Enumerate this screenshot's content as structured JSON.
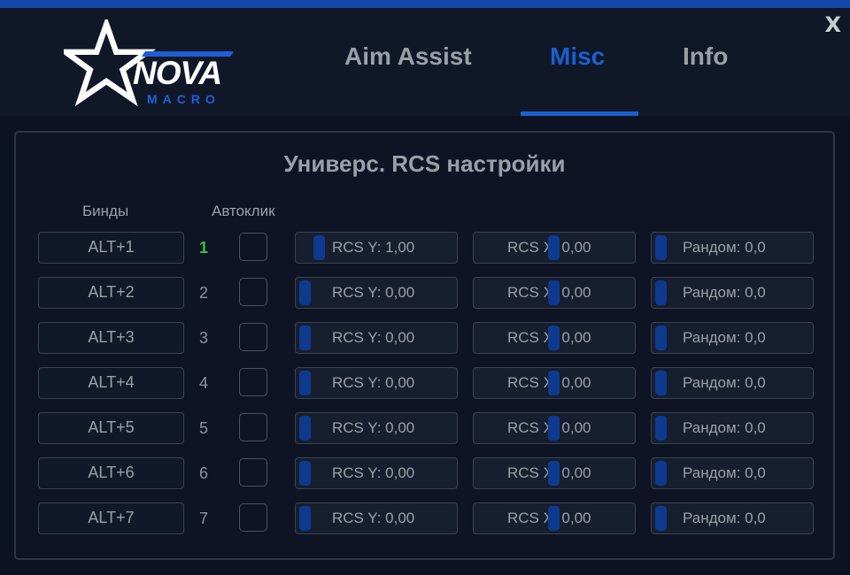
{
  "window": {
    "close_label": "X"
  },
  "logo": {
    "name": "NOVA",
    "sub": "MACRO"
  },
  "tabs": [
    {
      "label": "Aim Assist",
      "active": false
    },
    {
      "label": "Misc",
      "active": true
    },
    {
      "label": "Info",
      "active": false
    }
  ],
  "panel": {
    "title": "Универс. RCS настройки",
    "col_binds": "Бинды",
    "col_autoclick": "Автоклик"
  },
  "rows": [
    {
      "bind": "ALT+1",
      "num": "1",
      "active": true,
      "autoclick": false,
      "rcs_y": "RCS Y: 1,00",
      "rcs_x": "RCS X: 0,00",
      "random": "Рандом: 0,0",
      "rcs_y_level": 0.1,
      "rcs_x_level": 0.5,
      "random_level": 0
    },
    {
      "bind": "ALT+2",
      "num": "2",
      "active": false,
      "autoclick": false,
      "rcs_y": "RCS Y: 0,00",
      "rcs_x": "RCS X: 0,00",
      "random": "Рандом: 0,0",
      "rcs_y_level": 0,
      "rcs_x_level": 0.5,
      "random_level": 0
    },
    {
      "bind": "ALT+3",
      "num": "3",
      "active": false,
      "autoclick": false,
      "rcs_y": "RCS Y: 0,00",
      "rcs_x": "RCS X: 0,00",
      "random": "Рандом: 0,0",
      "rcs_y_level": 0,
      "rcs_x_level": 0.5,
      "random_level": 0
    },
    {
      "bind": "ALT+4",
      "num": "4",
      "active": false,
      "autoclick": false,
      "rcs_y": "RCS Y: 0,00",
      "rcs_x": "RCS X: 0,00",
      "random": "Рандом: 0,0",
      "rcs_y_level": 0,
      "rcs_x_level": 0.5,
      "random_level": 0
    },
    {
      "bind": "ALT+5",
      "num": "5",
      "active": false,
      "autoclick": false,
      "rcs_y": "RCS Y: 0,00",
      "rcs_x": "RCS X: 0,00",
      "random": "Рандом: 0,0",
      "rcs_y_level": 0,
      "rcs_x_level": 0.5,
      "random_level": 0
    },
    {
      "bind": "ALT+6",
      "num": "6",
      "active": false,
      "autoclick": false,
      "rcs_y": "RCS Y: 0,00",
      "rcs_x": "RCS X: 0,00",
      "random": "Рандом: 0,0",
      "rcs_y_level": 0,
      "rcs_x_level": 0.5,
      "random_level": 0
    },
    {
      "bind": "ALT+7",
      "num": "7",
      "active": false,
      "autoclick": false,
      "rcs_y": "RCS Y: 0,00",
      "rcs_x": "RCS X: 0,00",
      "random": "Рандом: 0,0",
      "rcs_y_level": 0,
      "rcs_x_level": 0.5,
      "random_level": 0
    }
  ],
  "colors": {
    "accent": "#1a5fcf",
    "active_index": "#36c04a",
    "background": "#0c1222"
  }
}
